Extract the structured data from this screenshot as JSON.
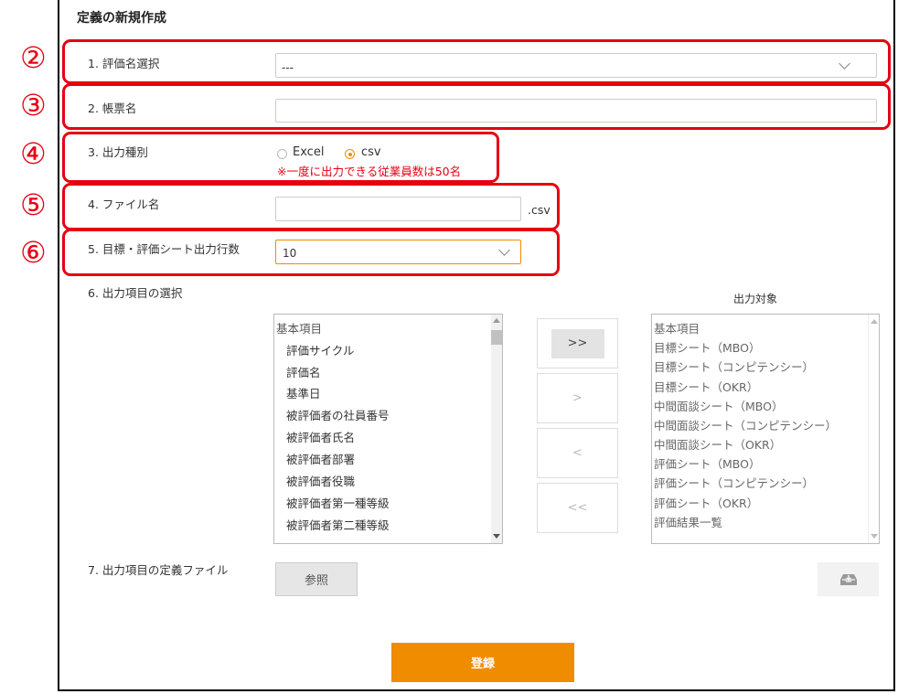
{
  "title": "定義の新規作成",
  "annotations": [
    "②",
    "③",
    "④",
    "⑤",
    "⑥"
  ],
  "fields": {
    "eval_name": {
      "label": "1. 評価名選択",
      "value": "---"
    },
    "report_name": {
      "label": "2. 帳票名",
      "value": ""
    },
    "output_type": {
      "label": "3. 出力種別",
      "option_excel": "Excel",
      "option_csv": "csv",
      "selected": "csv",
      "note": "※一度に出力できる従業員数は50名"
    },
    "file_name": {
      "label": "4. ファイル名",
      "value": "",
      "suffix": ".csv"
    },
    "rows": {
      "label": "5. 目標・評価シート出力行数",
      "value": "10"
    },
    "items": {
      "label": "6. 出力項目の選択",
      "target_label": "出力対象"
    },
    "def_file": {
      "label": "7. 出力項目の定義ファイル",
      "browse": "参照"
    }
  },
  "left_list": {
    "header": "基本項目",
    "items": [
      "評価サイクル",
      "評価名",
      "基準日",
      "被評価者の社員番号",
      "被評価者氏名",
      "被評価者部署",
      "被評価者役職",
      "被評価者第一種等級",
      "被評価者第二種等級"
    ]
  },
  "right_list": {
    "items": [
      "基本項目",
      "目標シート（MBO）",
      "目標シート（コンピテンシー）",
      "目標シート（OKR）",
      "中間面談シート（MBO）",
      "中間面談シート（コンピテンシー）",
      "中間面談シート（OKR）",
      "評価シート（MBO）",
      "評価シート（コンピテンシー）",
      "評価シート（OKR）",
      "評価結果一覧"
    ]
  },
  "transfer_buttons": [
    ">>",
    ">",
    "<",
    "<<"
  ],
  "submit": "登録",
  "colors": {
    "accent": "#f08c00",
    "annotation": "#e60012"
  }
}
